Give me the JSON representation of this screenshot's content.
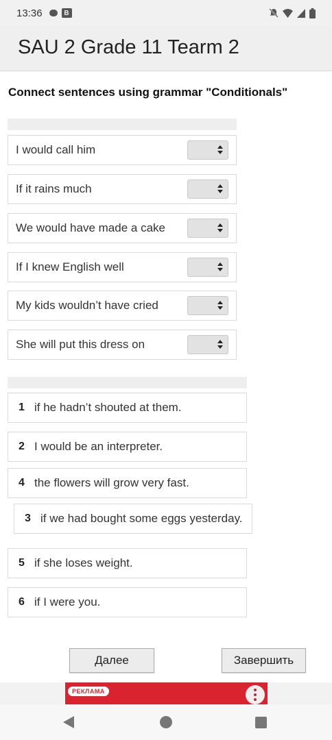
{
  "status_bar": {
    "time": "13:36",
    "left_icons": [
      "chat-bubble-icon",
      "b-badge-icon"
    ],
    "right_icons": [
      "bell-muted-icon",
      "wifi-icon",
      "signal-icon",
      "battery-icon"
    ]
  },
  "header": {
    "title": "SAU 2 Grade 11 Tearm 2"
  },
  "instruction": "Connect sentences using grammar \"Conditionals\"",
  "sentences": [
    {
      "text": "I would call him"
    },
    {
      "text": "If it rains much"
    },
    {
      "text": "We would have made a cake"
    },
    {
      "text": "If I knew English well"
    },
    {
      "text": "My kids wouldn’t have cried"
    },
    {
      "text": "She will put this dress on"
    }
  ],
  "answers": [
    {
      "num": "1",
      "text": "if he hadn’t shouted at them."
    },
    {
      "num": "2",
      "text": "I would be an interpreter."
    },
    {
      "num": "4",
      "text": "the flowers will grow very fast."
    },
    {
      "num": "3",
      "text": "if we had bought some eggs yesterday."
    },
    {
      "num": "5",
      "text": "if she loses weight."
    },
    {
      "num": "6",
      "text": "if I were you."
    }
  ],
  "buttons": {
    "next_label": "Далее",
    "finish_label": "Завершить"
  },
  "ad": {
    "badge": "РЕКЛАМА",
    "color": "#d9232e"
  },
  "nav_bar": {
    "icons": [
      "back-icon",
      "home-icon",
      "recents-icon"
    ]
  }
}
